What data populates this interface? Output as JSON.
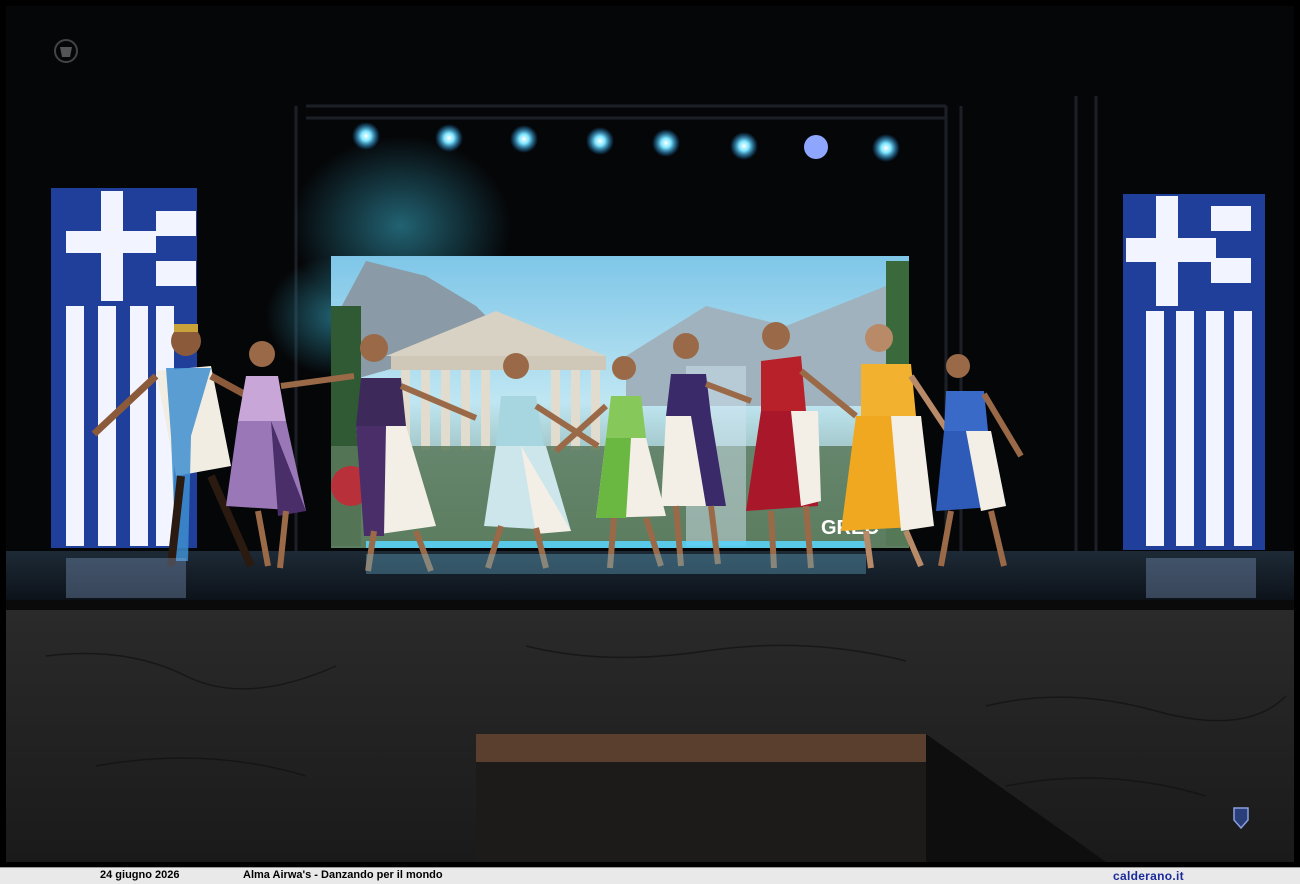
{
  "caption": {
    "date": "24 giugno 2026",
    "title": "Alma Airwa's - Danzando per il mondo",
    "site": "calderano.it"
  },
  "screen_text": "GREC",
  "colors": {
    "flag_blue": "#1f3f9a",
    "flag_white": "#f2f4ff",
    "stage_light": "#57d6ff",
    "caption_bg": "#e9e9e9",
    "site_link": "#1a2a9a"
  },
  "icons": {
    "top_left": "crest-icon",
    "bottom_right": "crest-icon"
  }
}
